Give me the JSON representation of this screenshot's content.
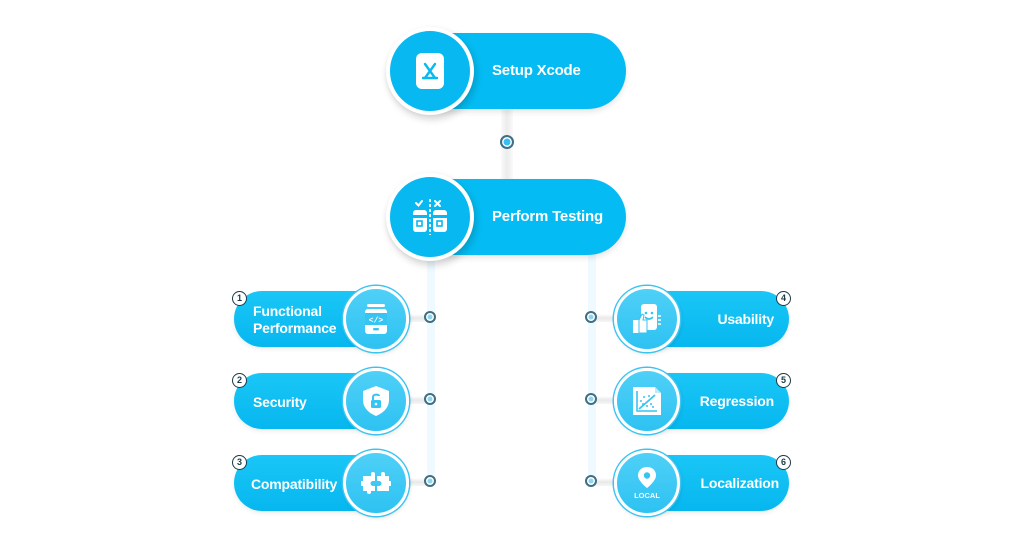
{
  "diagram": {
    "colors": {
      "primary": "#04bcf3",
      "circle_light": "#3ec8f4",
      "connector": "#eefaff",
      "dot_fill": "#8fd3ee",
      "dot_border": "#3f6f80",
      "text": "#ffffff"
    },
    "steps": [
      {
        "label": "Setup Xcode",
        "icon": "app-store-xcode-icon"
      },
      {
        "label": "Perform Testing",
        "icon": "ab-test-compare-icon"
      }
    ],
    "testing_types": {
      "left": [
        {
          "number": "1",
          "label_line1": "Functional",
          "label_line2": "Performance",
          "icon": "mobile-code-icon"
        },
        {
          "number": "2",
          "label": "Security",
          "icon": "shield-unlock-icon"
        },
        {
          "number": "3",
          "label": "Compatibility",
          "icon": "puzzle-pieces-icon"
        }
      ],
      "right": [
        {
          "number": "4",
          "label": "Usability",
          "icon": "phone-thumbs-up-icon"
        },
        {
          "number": "5",
          "label": "Regression",
          "icon": "regression-chart-icon"
        },
        {
          "number": "6",
          "label": "Localization",
          "icon": "location-pin-icon",
          "icon_text": "LOCAL"
        }
      ]
    }
  }
}
